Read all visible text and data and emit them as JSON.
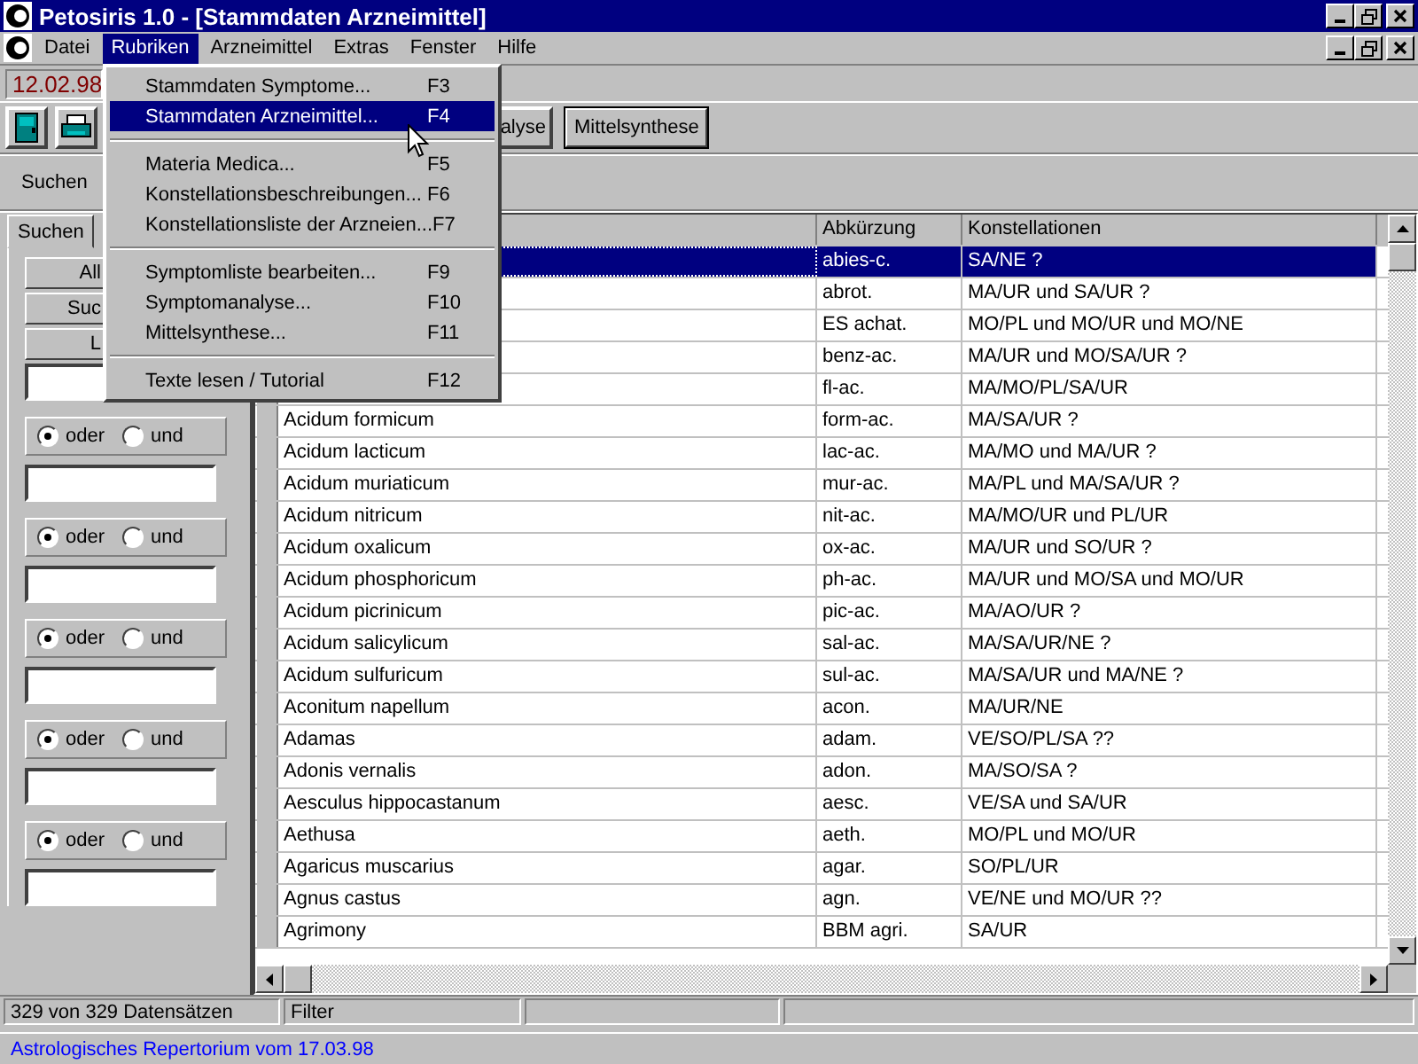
{
  "window": {
    "title": "Petosiris 1.0 - [Stammdaten Arzneimittel]"
  },
  "menu_bar": [
    {
      "label": "Datei",
      "selected": false
    },
    {
      "label": "Rubriken",
      "selected": true
    },
    {
      "label": "Arzneimittel",
      "selected": false
    },
    {
      "label": "Extras",
      "selected": false
    },
    {
      "label": "Fenster",
      "selected": false
    },
    {
      "label": "Hilfe",
      "selected": false
    }
  ],
  "dropdown": [
    {
      "kind": "item",
      "label": "Stammdaten Symptome...",
      "shortcut": "F3",
      "selected": false
    },
    {
      "kind": "item",
      "label": "Stammdaten Arzneimittel...",
      "shortcut": "F4",
      "selected": true
    },
    {
      "kind": "separator"
    },
    {
      "kind": "item",
      "label": "Materia Medica...",
      "shortcut": "F5",
      "selected": false
    },
    {
      "kind": "item",
      "label": "Konstellationsbeschreibungen...",
      "shortcut": "F6",
      "selected": false
    },
    {
      "kind": "item",
      "label": "Konstellationsliste der Arzneien...",
      "shortcut": "F7",
      "selected": false
    },
    {
      "kind": "separator"
    },
    {
      "kind": "item",
      "label": "Symptomliste bearbeiten...",
      "shortcut": "F9",
      "selected": false
    },
    {
      "kind": "item",
      "label": "Symptomanalyse...",
      "shortcut": "F10",
      "selected": false
    },
    {
      "kind": "item",
      "label": "Mittelsynthese...",
      "shortcut": "F11",
      "selected": false
    },
    {
      "kind": "separator"
    },
    {
      "kind": "item",
      "label": "Texte lesen / Tutorial",
      "shortcut": "F12",
      "selected": false
    }
  ],
  "date_field": {
    "value": "12.02.98"
  },
  "toolbar": [
    {
      "kind": "icon"
    },
    {
      "kind": "icon"
    },
    {
      "kind": "text",
      "label": "alyse",
      "default": false
    },
    {
      "kind": "text",
      "label": "Mittelsynthese",
      "default": true
    }
  ],
  "search_bar": {
    "label": "Suchen"
  },
  "left_panel": {
    "tab": {
      "label": "Suchen",
      "selected": true
    },
    "buttons": [
      "All",
      "Suc",
      "L"
    ],
    "criteria": [
      {
        "options": [
          {
            "label": "oder",
            "selected": true
          },
          {
            "label": "und",
            "selected": false
          }
        ]
      },
      {
        "options": [
          {
            "label": "oder",
            "selected": true
          },
          {
            "label": "und",
            "selected": false
          }
        ]
      },
      {
        "options": [
          {
            "label": "oder",
            "selected": true
          },
          {
            "label": "und",
            "selected": false
          }
        ]
      },
      {
        "options": [
          {
            "label": "oder",
            "selected": true
          },
          {
            "label": "und",
            "selected": false
          }
        ]
      },
      {
        "options": [
          {
            "label": "oder",
            "selected": true
          },
          {
            "label": "und",
            "selected": false
          }
        ]
      }
    ]
  },
  "table": {
    "columns": [
      "Abkürzung",
      "Konstellationen"
    ],
    "rows": [
      {
        "abbreviation": "abies-c.",
        "constellations": "SA/NE ?",
        "selected": true
      },
      {
        "abbreviation": "abrot.",
        "constellations": "MA/UR und SA/UR ?",
        "selected": false
      },
      {
        "abbreviation": "ES achat.",
        "constellations": "MO/PL und MO/UR und MO/NE",
        "selected": false
      },
      {
        "abbreviation": "benz-ac.",
        "constellations": "MA/UR und MO/SA/UR ?",
        "selected": false
      },
      {
        "abbreviation": "fl-ac.",
        "constellations": "MA/MO/PL/SA/UR",
        "selected": false
      },
      {
        "name": "Acidum formicum",
        "abbreviation": "form-ac.",
        "constellations": "MA/SA/UR ?",
        "selected": false
      },
      {
        "name": "Acidum lacticum",
        "abbreviation": "lac-ac.",
        "constellations": "MA/MO und MA/UR ?",
        "selected": false
      },
      {
        "name": "Acidum muriaticum",
        "abbreviation": "mur-ac.",
        "constellations": "MA/PL und MA/SA/UR ?",
        "selected": false
      },
      {
        "name": "Acidum nitricum",
        "abbreviation": "nit-ac.",
        "constellations": "MA/MO/UR und PL/UR",
        "selected": false
      },
      {
        "name": "Acidum oxalicum",
        "abbreviation": "ox-ac.",
        "constellations": "MA/UR und SO/UR ?",
        "selected": false
      },
      {
        "name": "Acidum phosphoricum",
        "abbreviation": "ph-ac.",
        "constellations": "MA/UR und MO/SA und MO/UR",
        "selected": false
      },
      {
        "name": "Acidum picrinicum",
        "abbreviation": "pic-ac.",
        "constellations": "MA/AO/UR ?",
        "selected": false
      },
      {
        "name": "Acidum salicylicum",
        "abbreviation": "sal-ac.",
        "constellations": "MA/SA/UR/NE ?",
        "selected": false
      },
      {
        "name": "Acidum sulfuricum",
        "abbreviation": "sul-ac.",
        "constellations": "MA/SA/UR und MA/NE ?",
        "selected": false
      },
      {
        "name": "Aconitum napellum",
        "abbreviation": "acon.",
        "constellations": "MA/UR/NE",
        "selected": false
      },
      {
        "name": "Adamas",
        "abbreviation": "adam.",
        "constellations": "VE/SO/PL/SA ??",
        "selected": false
      },
      {
        "name": "Adonis vernalis",
        "abbreviation": "adon.",
        "constellations": "MA/SO/SA ?",
        "selected": false
      },
      {
        "name": "Aesculus hippocastanum",
        "abbreviation": "aesc.",
        "constellations": "VE/SA und SA/UR",
        "selected": false
      },
      {
        "name": "Aethusa",
        "abbreviation": "aeth.",
        "constellations": "MO/PL und MO/UR",
        "selected": false
      },
      {
        "name": "Agaricus muscarius",
        "abbreviation": "agar.",
        "constellations": "SO/PL/UR",
        "selected": false
      },
      {
        "name": "Agnus castus",
        "abbreviation": "agn.",
        "constellations": "VE/NE und MO/UR ??",
        "selected": false
      },
      {
        "name": "Agrimony",
        "abbreviation": "BBM agri.",
        "constellations": "SA/UR",
        "selected": false
      }
    ]
  },
  "status_bar": {
    "record_count": "329 von 329 Datensätzen",
    "filter": "Filter"
  },
  "footer": "Astrologisches Repertorium vom 17.03.98"
}
